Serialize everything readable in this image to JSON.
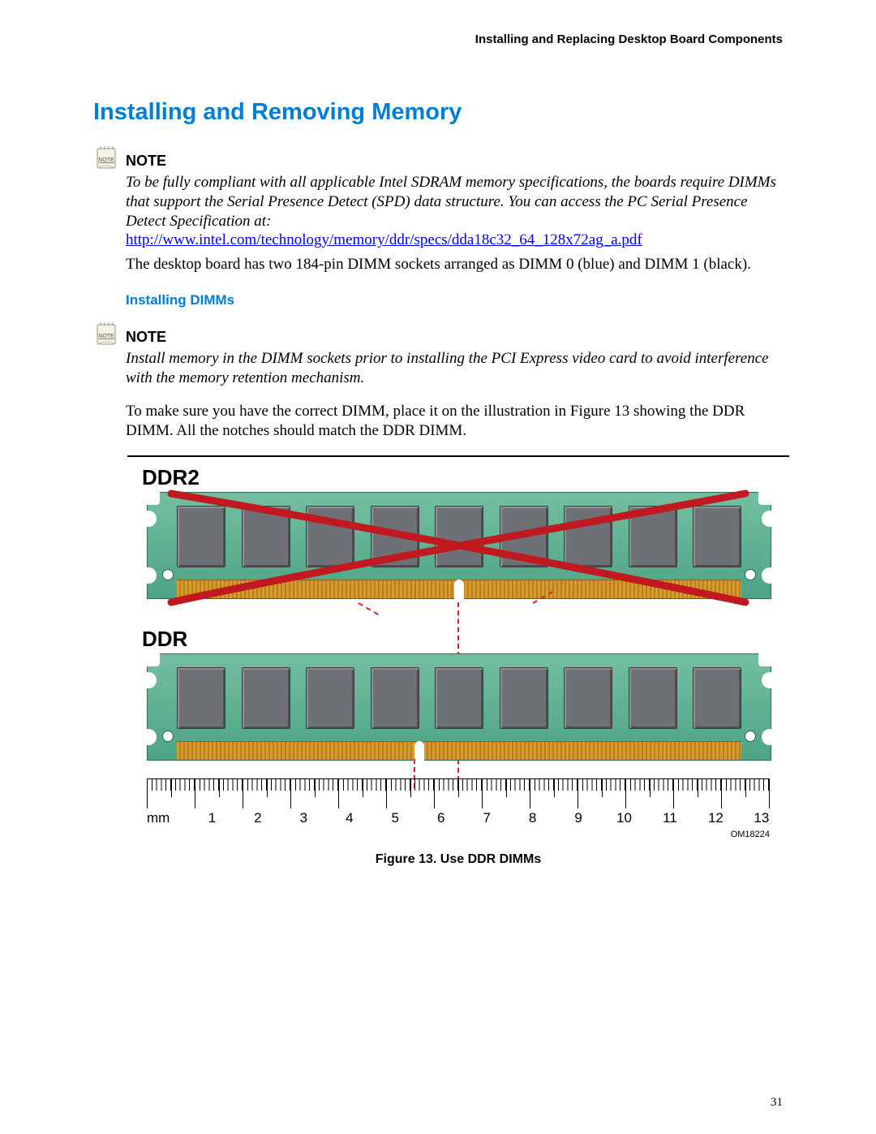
{
  "header": "Installing and Replacing Desktop Board Components",
  "title": "Installing and Removing Memory",
  "notes": {
    "label": "NOTE",
    "first_italic": "To be fully compliant with all applicable Intel SDRAM memory specifications, the boards require DIMMs that support the Serial Presence Detect (SPD) data structure.  You can access the PC Serial Presence Detect Specification at:",
    "link": "http://www.intel.com/technology/memory/ddr/specs/dda18c32_64_128x72ag_a.pdf",
    "after_link": "The desktop board has two 184-pin DIMM sockets arranged as DIMM 0 (blue) and DIMM 1 (black).",
    "second_italic": "Install memory in the DIMM sockets prior to installing the PCI Express video card to avoid interference with the memory retention mechanism."
  },
  "subhead": "Installing DIMMs",
  "para2": "To make sure you have the correct DIMM, place it on the illustration in Figure 13 showing the DDR DIMM.  All the notches should match the DDR DIMM.",
  "figure": {
    "label_ddr2": "DDR2",
    "label_ddr": "DDR",
    "mm": "mm",
    "numbers": [
      "1",
      "2",
      "3",
      "4",
      "5",
      "6",
      "7",
      "8",
      "9",
      "10",
      "11",
      "12",
      "13"
    ],
    "om": "OM18224",
    "caption": "Figure 13.  Use DDR DIMMs"
  },
  "page_number": "31"
}
